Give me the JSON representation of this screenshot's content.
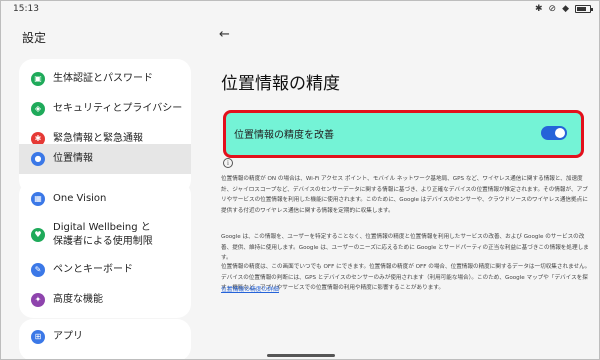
{
  "status_bar": {
    "time": "15:13",
    "icons": [
      "bluetooth-icon",
      "mute-icon",
      "wifi-icon",
      "battery-icon"
    ]
  },
  "left_panel": {
    "title": "設定",
    "items": [
      {
        "label": "生体認証とパスワード",
        "icon": "lock-icon",
        "color": "#1faa5a"
      },
      {
        "label": "セキュリティとプライバシー",
        "icon": "shield-icon",
        "color": "#1faa5a"
      },
      {
        "label": "緊急情報と緊急通報",
        "icon": "asterisk-icon",
        "color": "#e53935"
      },
      {
        "label": "位置情報",
        "icon": "location-pin-icon",
        "color": "#3b78e7",
        "selected": true
      },
      {
        "label": "One Vision",
        "icon": "one-vision-icon",
        "color": "#3b78e7"
      },
      {
        "label_line1": "Digital Wellbeing と",
        "label_line2": "保護者による使用制限",
        "icon": "wellbeing-icon",
        "color": "#1faa5a"
      },
      {
        "label": "ペンとキーボード",
        "icon": "pen-icon",
        "color": "#3b78e7"
      },
      {
        "label": "高度な機能",
        "icon": "advanced-features-icon",
        "color": "#8e44ad"
      },
      {
        "label": "アプリ",
        "icon": "apps-grid-icon",
        "color": "#3b78e7"
      }
    ]
  },
  "right_panel": {
    "back_icon": "back-arrow-icon",
    "title": "位置情報の精度",
    "toggle": {
      "label": "位置情報の精度を改善",
      "state": "on",
      "accent": "#2563d9",
      "row_bg": "#74f3d6",
      "highlight_border": "#e3101c"
    },
    "info_icon": "info-icon",
    "paragraph1": "位置情報の精度が ON の場合は、Wi-Fi アクセス ポイント、モバイル ネットワーク基地局、GPS など、ワイヤレス通信に関する情報と、加速度計、ジャイロスコープなど、デバイスのセンサーデータに関する情報に基づき、より正確なデバイスの位置情報が推定されます。その情報が、アプリやサービスの位置情報を利用した機能に使用されます。このために、Google はデバイスのセンサーや、クラウドソースのワイヤレス通信拠点に提供する付近のワイヤレス通信に関する情報を定期的に収集します。",
    "paragraph2": "Google は、この情報を、ユーザーを特定することなく、位置情報の精度と位置情報を利用したサービスの改善、および Google のサービスの改善、提供、維持に使用します。Google は、ユーザーのニーズに応えるために Google とサードパーティの正当な利益に基づきこの情報を処理します。",
    "paragraph3": "位置情報の精度は、この画面でいつでも OFF にできます。位置情報の精度が OFF の場合、位置情報の精度に関するデータは一切収集されません。デバイスの位置情報の判断には、GPS とデバイスのセンサーのみが使用されます（利用可能な場合）。このため、Google マップや「デバイスを探す」機能など、アプリやサービスでの位置情報の利用や精度に影響することがあります。",
    "link": "位置情報の精度の詳細"
  }
}
